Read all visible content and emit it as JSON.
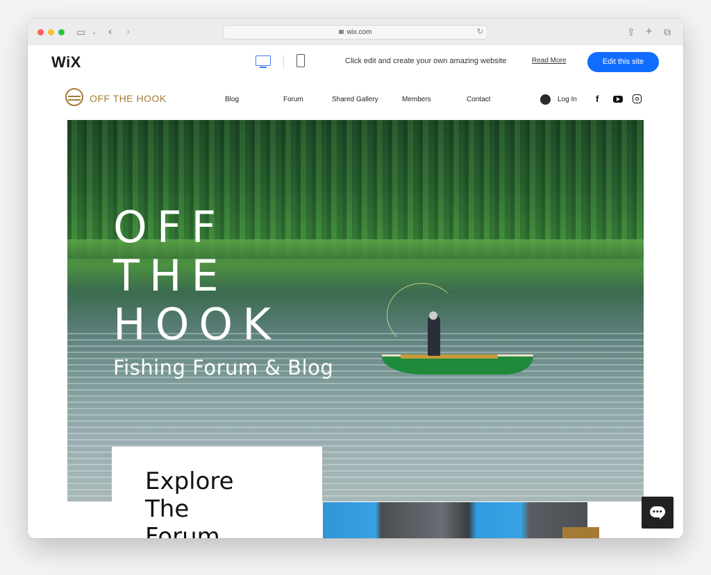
{
  "browser": {
    "url": "wix.com",
    "icons": [
      "sidebar-icon",
      "chevron-down-icon",
      "back-icon",
      "forward-icon",
      "lock-icon",
      "reload-icon",
      "share-icon",
      "new-tab-icon",
      "tabs-icon"
    ]
  },
  "wix_bar": {
    "logo": "WiX",
    "prompt": "Click edit and create your own amazing website",
    "read_more": "Read More",
    "edit_button": "Edit this site",
    "accent": "#116dff"
  },
  "site": {
    "logo_text": "OFF THE HOOK",
    "brand_color": "#a47a35",
    "nav": [
      {
        "label": "Blog"
      },
      {
        "label": "Forum"
      },
      {
        "label": "Shared Gallery"
      },
      {
        "label": "Members"
      },
      {
        "label": "Contact"
      }
    ],
    "login": "Log In",
    "social": [
      "facebook-icon",
      "youtube-icon",
      "instagram-icon"
    ]
  },
  "hero": {
    "title_lines": [
      "OFF",
      "THE",
      "HOOK"
    ],
    "subtitle": "Fishing Forum & Blog"
  },
  "explore": {
    "title_lines": [
      "Explore",
      "The",
      "Forum"
    ]
  }
}
